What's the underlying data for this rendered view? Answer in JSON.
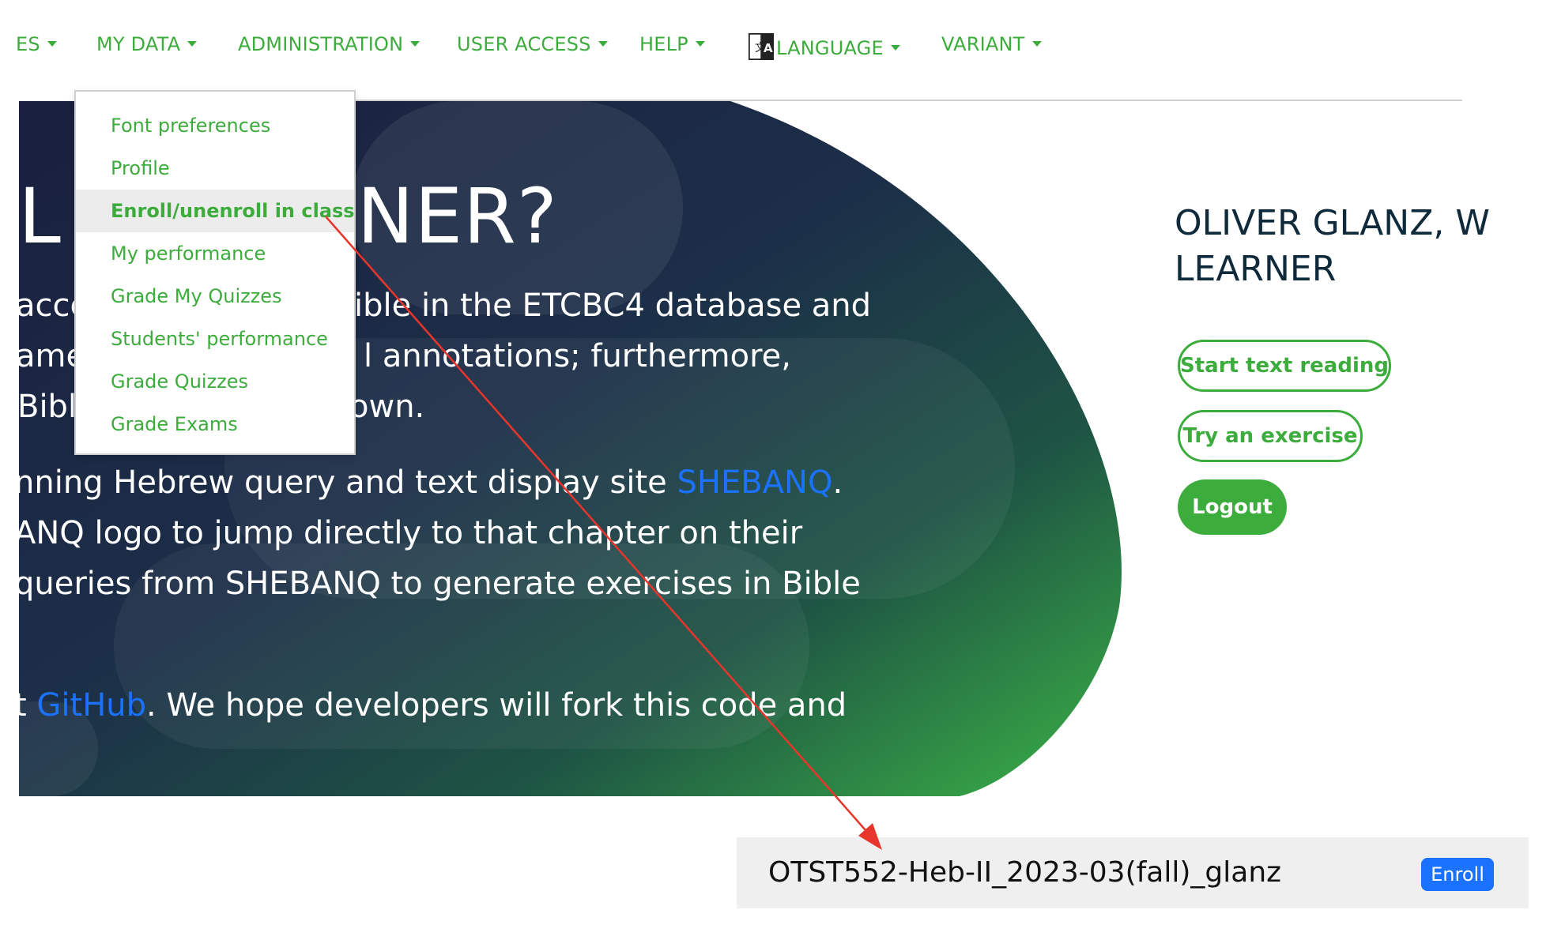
{
  "nav": {
    "items": [
      {
        "label": "ES"
      },
      {
        "label": "MY DATA"
      },
      {
        "label": "ADMINISTRATION"
      },
      {
        "label": "USER ACCESS"
      },
      {
        "label": "HELP"
      },
      {
        "label": "LANGUAGE",
        "icon": "translate-icon"
      },
      {
        "label": "VARIANT"
      }
    ],
    "accent_color": "#3cac3c"
  },
  "dropdown": {
    "items": [
      {
        "label": "Font preferences"
      },
      {
        "label": "Profile"
      },
      {
        "label": "Enroll/unenroll in class",
        "active": true
      },
      {
        "label": "My performance"
      },
      {
        "label": "Grade My Quizzes"
      },
      {
        "label": "Students' performance"
      },
      {
        "label": "Grade Quizzes"
      },
      {
        "label": "Grade Exams"
      }
    ]
  },
  "hero": {
    "title_left": "IL",
    "title_right": "RNER?",
    "lines": [
      {
        "left": "acce",
        "right": "ible in the ETCBC4 database and"
      },
      {
        "left": "ame",
        "right": "l annotations; furthermore,"
      },
      {
        "left": "Bibl",
        "right": "own."
      }
    ],
    "line4_text": "nning Hebrew query and text display site ",
    "line4_link": "SHEBANQ",
    "line4_end": ".",
    "line5": "ANQ logo to jump directly to that chapter on their",
    "line6": " queries from SHEBANQ to generate exercises in Bible",
    "line7_start": "t ",
    "line7_link": "GitHub",
    "line7_end": ". We hope developers will fork this code and",
    "link_color": "#1a72ff"
  },
  "user": {
    "name_line1": "OLIVER GLANZ, W",
    "name_line2": "LEARNER"
  },
  "buttons": {
    "start_reading": "Start text reading",
    "try_exercise": "Try an exercise",
    "logout": "Logout"
  },
  "enroll": {
    "class_name": "OTST552-Heb-II_2023-03(fall)_glanz",
    "button_label": "Enroll"
  }
}
